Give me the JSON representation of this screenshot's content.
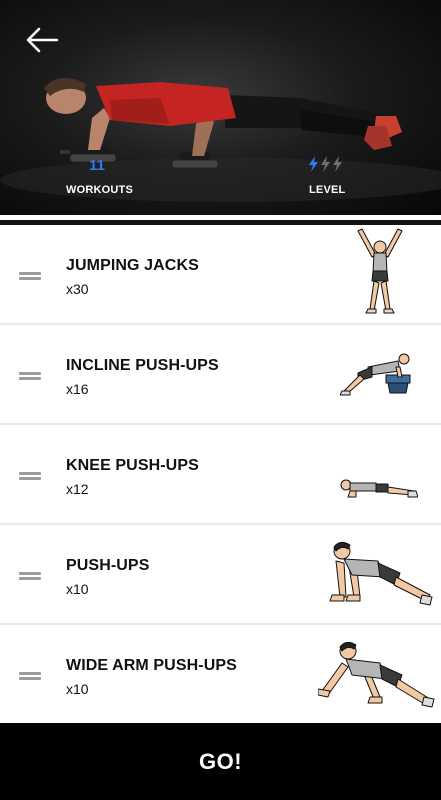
{
  "header": {
    "back_icon": "arrow-left-icon",
    "workouts_count": "11",
    "workouts_label": "WORKOUTS",
    "level_label": "LEVEL",
    "level_icon": "lightning-bolt-icon",
    "level_value": 1,
    "level_max": 3,
    "accent_color": "#2d7cf2"
  },
  "exercises": [
    {
      "name": "JUMPING JACKS",
      "reps": "x30"
    },
    {
      "name": "INCLINE PUSH-UPS",
      "reps": "x16"
    },
    {
      "name": "KNEE PUSH-UPS",
      "reps": "x12"
    },
    {
      "name": "PUSH-UPS",
      "reps": "x10"
    },
    {
      "name": "WIDE ARM PUSH-UPS",
      "reps": "x10"
    }
  ],
  "footer": {
    "go_label": "GO!"
  }
}
